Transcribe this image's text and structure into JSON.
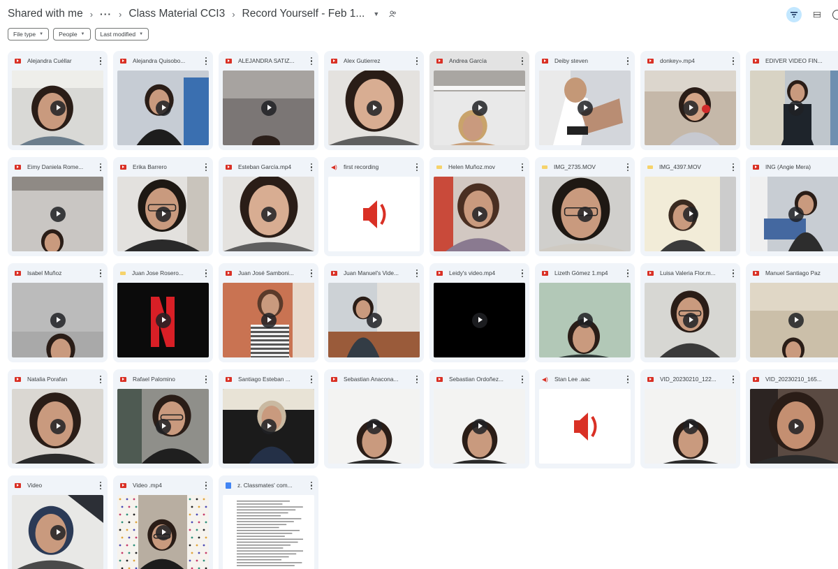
{
  "breadcrumb": {
    "root": "Shared with me",
    "ellipsis": "···",
    "parent": "Class Material CCI3",
    "current": "Record Yourself - Feb 1..."
  },
  "chips": [
    {
      "label": "File type"
    },
    {
      "label": "People"
    },
    {
      "label": "Last modified"
    }
  ],
  "colors": {
    "accent": "#c2e7ff",
    "video": "#d93025",
    "card": "#f0f4f9"
  },
  "files": [
    {
      "name": "Alejandra Cuéllar",
      "type": "video",
      "thumb": "face-light"
    },
    {
      "name": "Alejandra Quisobo...",
      "type": "video",
      "thumb": "face-room"
    },
    {
      "name": "ALEJANDRA SATIZ...",
      "type": "video",
      "thumb": "dark-room"
    },
    {
      "name": "Alex Gutierrez",
      "type": "video",
      "thumb": "face-close"
    },
    {
      "name": "Andrea García",
      "type": "video",
      "thumb": "ceiling",
      "selected": true
    },
    {
      "name": "Deiby steven",
      "type": "video",
      "thumb": "face-side"
    },
    {
      "name": "donkey».mp4",
      "type": "video",
      "thumb": "headset"
    },
    {
      "name": "EDIVER VIDEO FIN...",
      "type": "video",
      "thumb": "uniform"
    },
    {
      "name": "Eimy Daniela Rome...",
      "type": "video",
      "thumb": "ceiling-dark"
    },
    {
      "name": "Erika Barrero",
      "type": "video",
      "thumb": "face-glasses"
    },
    {
      "name": "Esteban García.mp4",
      "type": "video",
      "thumb": "face-close"
    },
    {
      "name": "first recording",
      "type": "audio",
      "thumb": "audio"
    },
    {
      "name": "Helen Muñoz.mov",
      "type": "mov",
      "thumb": "face-hair"
    },
    {
      "name": "IMG_2735.MOV",
      "type": "mov",
      "thumb": "face-glasses-big"
    },
    {
      "name": "IMG_4397.MOV",
      "type": "mov",
      "thumb": "face-bright"
    },
    {
      "name": "ING (Angie Mera)",
      "type": "video",
      "thumb": "classroom"
    },
    {
      "name": "Isabel Muñoz",
      "type": "video",
      "thumb": "ceiling-face"
    },
    {
      "name": "Juan Jose Rosero...",
      "type": "mov",
      "thumb": "netflix"
    },
    {
      "name": "Juan José Samboni...",
      "type": "video",
      "thumb": "orange-wall"
    },
    {
      "name": "Juan Manuel's Vide...",
      "type": "video",
      "thumb": "uniform-sit"
    },
    {
      "name": "Leidy's video.mp4",
      "type": "video",
      "thumb": "black"
    },
    {
      "name": "Lizeth Gómez 1.mp4",
      "type": "video",
      "thumb": "green-wall"
    },
    {
      "name": "Luisa Valeria Flor.m...",
      "type": "video",
      "thumb": "face-glasses-room"
    },
    {
      "name": "Manuel Santiago Paz",
      "type": "video",
      "thumb": "beige-room"
    },
    {
      "name": "Natalia Porafan",
      "type": "video",
      "thumb": "face-earring"
    },
    {
      "name": "Rafael Palomino",
      "type": "video",
      "thumb": "sunglasses"
    },
    {
      "name": "Santiago Esteban ...",
      "type": "video",
      "thumb": "suit"
    },
    {
      "name": "Sebastian Anacona...",
      "type": "video",
      "thumb": "white-face"
    },
    {
      "name": "Sebastian Ordoñez...",
      "type": "video",
      "thumb": "white-face"
    },
    {
      "name": "Stan Lee .aac",
      "type": "audio",
      "thumb": "audio"
    },
    {
      "name": "VID_20230210_122...",
      "type": "video",
      "thumb": "white-face"
    },
    {
      "name": "VID_20230210_165...",
      "type": "video",
      "thumb": "face-dark"
    },
    {
      "name": "Video",
      "type": "video",
      "thumb": "cap"
    },
    {
      "name": "Video .mp4",
      "type": "video",
      "thumb": "dots"
    },
    {
      "name": "z. Classmates' com...",
      "type": "doc",
      "thumb": "document"
    }
  ]
}
